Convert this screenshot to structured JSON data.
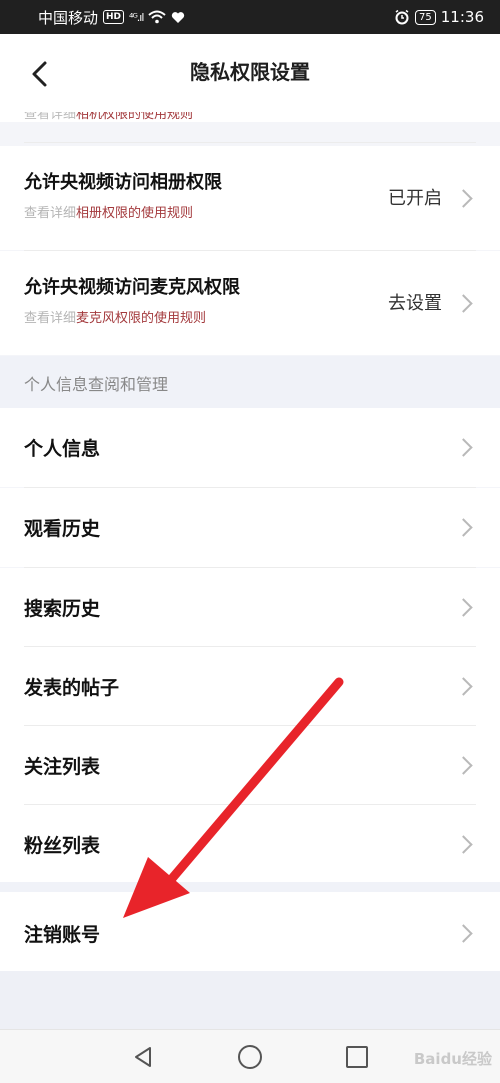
{
  "status_bar": {
    "carrier": "中国移动",
    "hd_badge": "HD",
    "signal": "⁴ᴳ.ıl",
    "battery": "75",
    "time": "11:36"
  },
  "header": {
    "title": "隐私权限设置",
    "back_icon": "chevron-left-icon"
  },
  "cut_row": {
    "prefix": "查看详细",
    "link": "相机权限的使用规则"
  },
  "permissions": [
    {
      "title": "允许央视频访问相册权限",
      "sub_prefix": "查看详细",
      "sub_link": "相册权限的使用规则",
      "status": "已开启"
    },
    {
      "title": "允许央视频访问麦克风权限",
      "sub_prefix": "查看详细",
      "sub_link": "麦克风权限的使用规则",
      "status": "去设置"
    }
  ],
  "section_header": "个人信息查阅和管理",
  "menu_items": [
    {
      "label": "个人信息"
    },
    {
      "label": "观看历史"
    },
    {
      "label": "搜索历史"
    },
    {
      "label": "发表的帖子"
    },
    {
      "label": "关注列表"
    },
    {
      "label": "粉丝列表"
    }
  ],
  "cancel_account": {
    "label": "注销账号"
  },
  "watermark": "Baidu经验",
  "colors": {
    "accent_red": "#a3393c",
    "annotation_arrow": "#e8242a",
    "section_bg": "#f0f2f8"
  }
}
